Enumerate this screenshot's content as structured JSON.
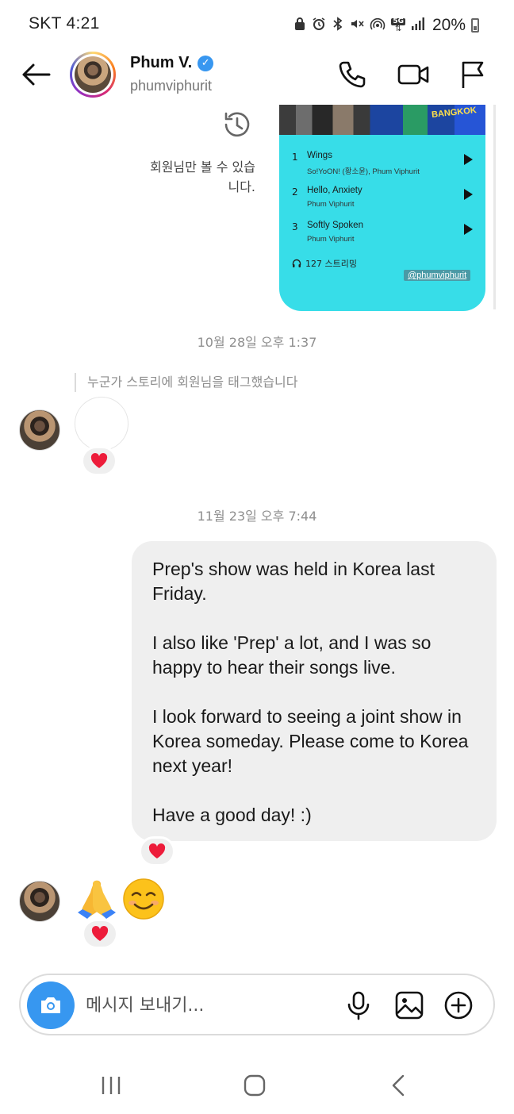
{
  "status_bar": {
    "carrier_time": "SKT 4:21",
    "battery": "20%",
    "network": "5G"
  },
  "header": {
    "name": "Phum V.",
    "handle": "phumviphurit",
    "verified_mark": "✓"
  },
  "shared_story": {
    "visibility_note": "회원님만 볼 수 있습니다.",
    "banner_text": "BANGKOK",
    "tracks": [
      {
        "num": "1",
        "title": "Wings",
        "artist": "So!YoON! (황소윤), Phum Viphurit"
      },
      {
        "num": "2",
        "title": "Hello, Anxiety",
        "artist": "Phum Viphurit"
      },
      {
        "num": "3",
        "title": "Softly Spoken",
        "artist": "Phum Viphurit"
      }
    ],
    "streams": "127 스트리밍",
    "handle_tag": "@phumviphurit"
  },
  "messages": {
    "timestamp_1": "10월 28일 오후 1:37",
    "tag_notice": "누군가 스토리에 회원님을 태그했습니다",
    "timestamp_2": "11월 23일 오후 7:44",
    "outgoing_paragraphs": [
      "Prep's show was held in Korea last Friday.",
      "I also like 'Prep' a lot, and I was so happy to hear their songs live.",
      "I look forward to seeing a joint show in Korea someday. Please come to Korea next year!",
      "Have a good day! :)"
    ],
    "reply_emojis": [
      "folded-hands",
      "smiling-face"
    ],
    "reaction_emoji": "red-heart"
  },
  "composer": {
    "placeholder": "메시지 보내기..."
  },
  "colors": {
    "accent_blue": "#3797f0",
    "story_bg": "#37dde8",
    "bubble_bg": "#efefef",
    "heart_red": "#ed1c3a",
    "muted_text": "#8e8e8e"
  }
}
